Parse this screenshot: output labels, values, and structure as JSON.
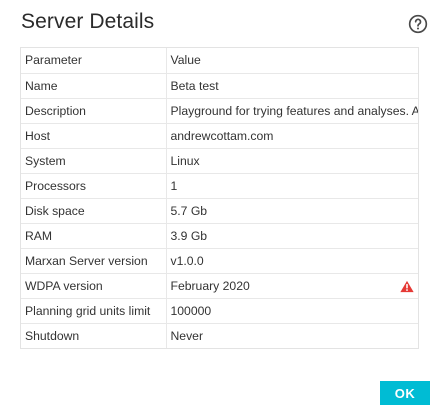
{
  "dialog": {
    "title": "Server Details",
    "help_icon": "help-circle-icon",
    "ok_label": "OK",
    "accent_color": "#00bcd4",
    "warning_color": "#e53935"
  },
  "table": {
    "headers": [
      "Parameter",
      "Value"
    ],
    "rows": [
      {
        "param": "Name",
        "value": "Beta test"
      },
      {
        "param": "Description",
        "value": "Playground for trying features and analyses. Al"
      },
      {
        "param": "Host",
        "value": "andrewcottam.com"
      },
      {
        "param": "System",
        "value": "Linux"
      },
      {
        "param": "Processors",
        "value": "1"
      },
      {
        "param": "Disk space",
        "value": "5.7 Gb"
      },
      {
        "param": "RAM",
        "value": "3.9 Gb"
      },
      {
        "param": "Marxan Server version",
        "value": "v1.0.0"
      },
      {
        "param": "WDPA version",
        "value": "February 2020",
        "icon": "warning-icon"
      },
      {
        "param": "Planning grid units limit",
        "value": "100000"
      },
      {
        "param": "Shutdown",
        "value": "Never"
      }
    ]
  }
}
